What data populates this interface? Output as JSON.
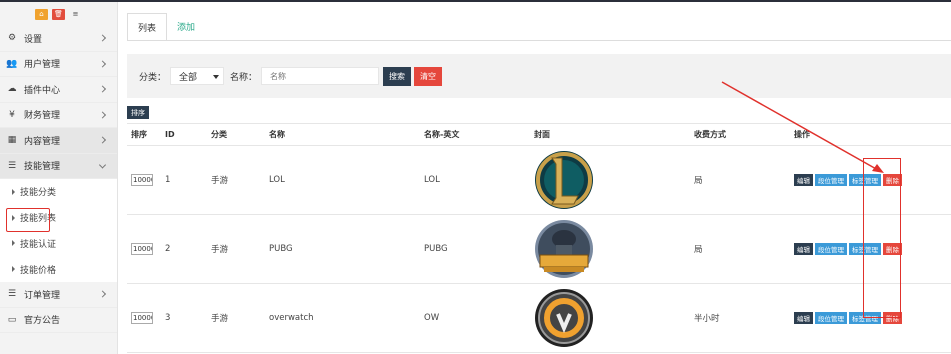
{
  "sidebar": {
    "top_buttons": [
      {
        "icon": "home-icon",
        "glyph": "⌂",
        "color": "#f0a22e"
      },
      {
        "icon": "trash-icon",
        "glyph": "🗑",
        "color": "#e24d3d"
      },
      {
        "icon": "list-icon",
        "glyph": "≡",
        "color": "#f3f3f3"
      }
    ],
    "items": [
      {
        "label": "设置",
        "icon": "gear-icon",
        "glyph": "⚙"
      },
      {
        "label": "用户管理",
        "icon": "users-icon",
        "glyph": "👥"
      },
      {
        "label": "插件中心",
        "icon": "cloud-icon",
        "glyph": "☁"
      },
      {
        "label": "财务管理",
        "icon": "yen-icon",
        "glyph": "¥"
      },
      {
        "label": "内容管理",
        "icon": "grid-icon",
        "glyph": "▦"
      },
      {
        "label": "技能管理",
        "icon": "menu-icon",
        "glyph": "☰"
      }
    ],
    "sub_items": [
      {
        "label": "技能分类"
      },
      {
        "label": "技能列表"
      },
      {
        "label": "技能认证"
      },
      {
        "label": "技能价格"
      }
    ],
    "bottom_items": [
      {
        "label": "订单管理",
        "icon": "menu-icon",
        "glyph": "☰"
      },
      {
        "label": "官方公告",
        "icon": "monitor-icon",
        "glyph": "▭"
      }
    ]
  },
  "tabs": [
    {
      "label": "列表"
    },
    {
      "label": "添加"
    }
  ],
  "filter": {
    "category_label": "分类：",
    "category_value": "全部",
    "name_label": "名称：",
    "name_placeholder": "名称",
    "search_label": "搜索",
    "clear_label": "清空"
  },
  "sort_button_label": "排序",
  "table": {
    "headers": [
      "排序",
      "ID",
      "分类",
      "名称",
      "名称-英文",
      "封面",
      "收费方式",
      "操作"
    ],
    "rows": [
      {
        "sort": "10000",
        "id": "1",
        "category": "手游",
        "name": "LOL",
        "name_en": "LOL",
        "cover": "lol-logo-icon",
        "fee": "局"
      },
      {
        "sort": "10000",
        "id": "2",
        "category": "手游",
        "name": "PUBG",
        "name_en": "PUBG",
        "cover": "pubg-logo-icon",
        "fee": "局"
      },
      {
        "sort": "10000",
        "id": "3",
        "category": "手游",
        "name": "overwatch",
        "name_en": "OW",
        "cover": "overwatch-logo-icon",
        "fee": "半小时"
      }
    ],
    "actions": {
      "edit": "编辑",
      "position": "段位管理",
      "tags": "标签管理",
      "delete": "删除"
    }
  },
  "colors": {
    "dark_button": "#2c3e50",
    "red_button": "#e5473c",
    "blue_button": "#3b9ad8",
    "tab_link": "#2aa98a",
    "annotation_red": "#e0312c"
  }
}
